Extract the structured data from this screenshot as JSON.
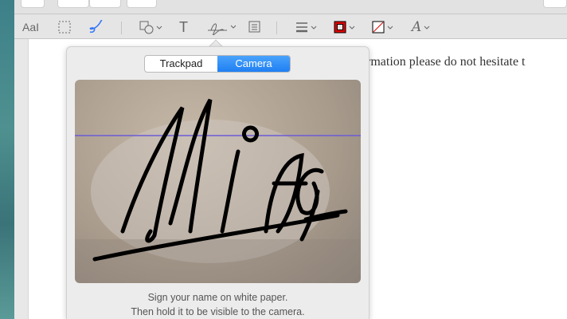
{
  "toolbar": {
    "icons": [
      "text-style-icon",
      "rect-select-icon",
      "sketch-icon",
      "shapes-icon",
      "text-icon",
      "signature-icon",
      "note-icon",
      "line-style-icon",
      "border-color-icon",
      "fill-color-icon",
      "font-icon"
    ],
    "border_color": "#e00000",
    "fill_none_color": "#e00000"
  },
  "document": {
    "text": "rmation please do not hesitate t"
  },
  "signature_popover": {
    "tabs": [
      {
        "label": "Trackpad",
        "selected": false
      },
      {
        "label": "Camera",
        "selected": true
      }
    ],
    "instructions_line1": "Sign your name on white paper.",
    "instructions_line2": "Then hold it to be visible to the camera.",
    "guide_color": "#6b5bd6"
  }
}
